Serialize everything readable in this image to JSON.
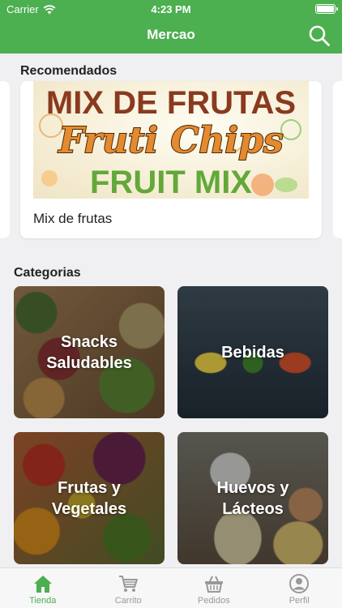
{
  "status": {
    "carrier": "Carrier",
    "time": "4:23 PM"
  },
  "nav": {
    "title": "Mercao"
  },
  "recommended": {
    "title": "Recomendados",
    "items": [
      {
        "label": "Mix de frutas",
        "image_text": [
          "MIX DE FRUTAS",
          "Fruti Chips",
          "FRUIT MIX"
        ]
      }
    ]
  },
  "categories": {
    "title": "Categorias",
    "items": [
      {
        "label": "Snacks\nSaludables"
      },
      {
        "label": "Bebidas"
      },
      {
        "label": "Frutas y\nVegetales"
      },
      {
        "label": "Huevos y\nLácteos"
      }
    ]
  },
  "tabs": [
    {
      "label": "Tienda",
      "icon": "home-icon",
      "active": true
    },
    {
      "label": "Carrito",
      "icon": "cart-icon",
      "active": false
    },
    {
      "label": "Pedidos",
      "icon": "basket-icon",
      "active": false
    },
    {
      "label": "Perfil",
      "icon": "profile-icon",
      "active": false
    }
  ],
  "colors": {
    "brand": "#4caf50",
    "tab_inactive": "#999999"
  }
}
